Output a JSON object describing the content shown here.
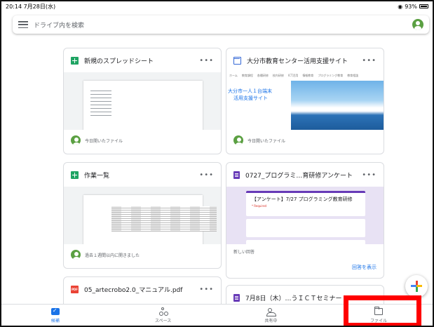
{
  "status_bar": {
    "time_date": "20:14  7月28日(水)",
    "battery": "93%"
  },
  "search": {
    "placeholder": "ドライブ内を検索"
  },
  "cards": [
    {
      "title": "新規のスプレッドシート",
      "type_icon": "sheets-icon",
      "footer": "今日開いたファイル"
    },
    {
      "title": "大分市教育センター活用支援サイト",
      "type_icon": "sites-icon",
      "footer": "今日開いたファイル",
      "preview": {
        "nav_items": [
          "ホーム",
          "教育課程",
          "各種研修",
          "校内研修",
          "ICT活用",
          "情報教育",
          "プログラミング教育",
          "教育相談"
        ],
        "site_heading_line1": "大分市一人１台端末",
        "site_heading_line2": "活用支援サイト"
      }
    },
    {
      "title": "作業一覧",
      "type_icon": "sheets-icon",
      "footer": "過去１週間以内に開きました"
    },
    {
      "title": "0727_プログラミ…育研修アンケート",
      "type_icon": "forms-icon",
      "footer": "新しい回答",
      "footer_link": "回答を表示",
      "preview": {
        "form_title": "【アンケート】7/27 プログラミング教育研修",
        "required_label": "* Required"
      }
    },
    {
      "title": "05_artecrobo2.0_マニュアル.pdf",
      "type_icon": "pdf-icon",
      "pdf_badge": "PDF"
    },
    {
      "title": "7月8日（木）…うＩＣＴセミナー",
      "type_icon": "forms-icon"
    }
  ],
  "bottom_nav": [
    {
      "label": "候補",
      "icon": "home-suggested-icon",
      "active": true
    },
    {
      "label": "スペース",
      "icon": "spaces-icon",
      "active": false
    },
    {
      "label": "共有中",
      "icon": "shared-icon",
      "active": false
    },
    {
      "label": "ファイル",
      "icon": "folder-icon",
      "active": false
    }
  ],
  "colors": {
    "accent_blue": "#1a73e8",
    "highlight_red": "#ff0000",
    "sheets_green": "#1fa463",
    "forms_purple": "#673ab7",
    "pdf_red": "#ea4335"
  }
}
